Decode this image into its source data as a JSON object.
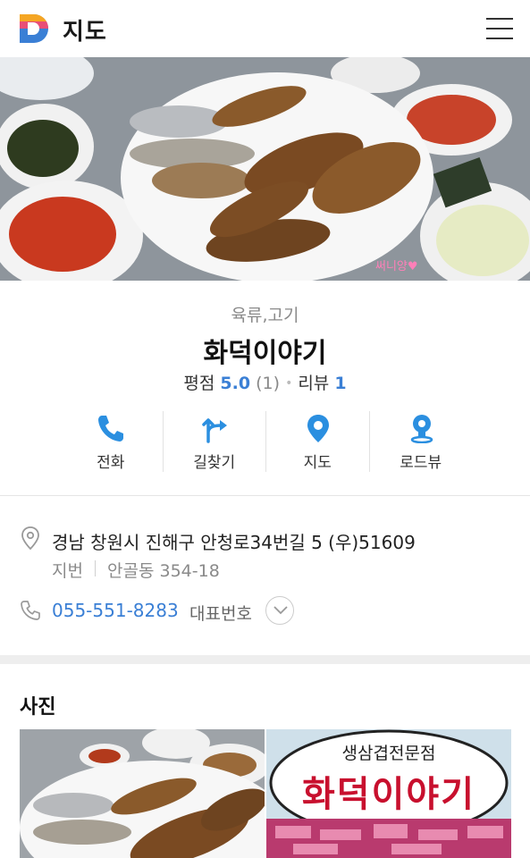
{
  "header": {
    "title": "지도",
    "logo_colors": [
      "#f5a623",
      "#e94e77",
      "#3a7fd5"
    ]
  },
  "hero": {
    "watermark": "써니양♥"
  },
  "place": {
    "category": "육류,고기",
    "name": "화덕이야기",
    "rating_label": "평점",
    "rating_value": "5.0",
    "rating_count": "(1)",
    "review_label": "리뷰",
    "review_count": "1"
  },
  "actions": [
    {
      "label": "전화",
      "icon": "phone-icon"
    },
    {
      "label": "길찾기",
      "icon": "directions-icon"
    },
    {
      "label": "지도",
      "icon": "map-pin-icon"
    },
    {
      "label": "로드뷰",
      "icon": "roadview-icon"
    }
  ],
  "address": {
    "road": "경남 창원시 진해구 안청로34번길 5 (우)51609",
    "jibun_label": "지번",
    "jibun_value": "안골동 354-18"
  },
  "phone": {
    "number": "055-551-8283",
    "type": "대표번호"
  },
  "photos": {
    "title": "사진",
    "sign_small": "생삼겹전문점",
    "sign_big": "화덕이야기"
  },
  "colors": {
    "accent": "#3a7fd5",
    "divider": "#eeeeee"
  }
}
